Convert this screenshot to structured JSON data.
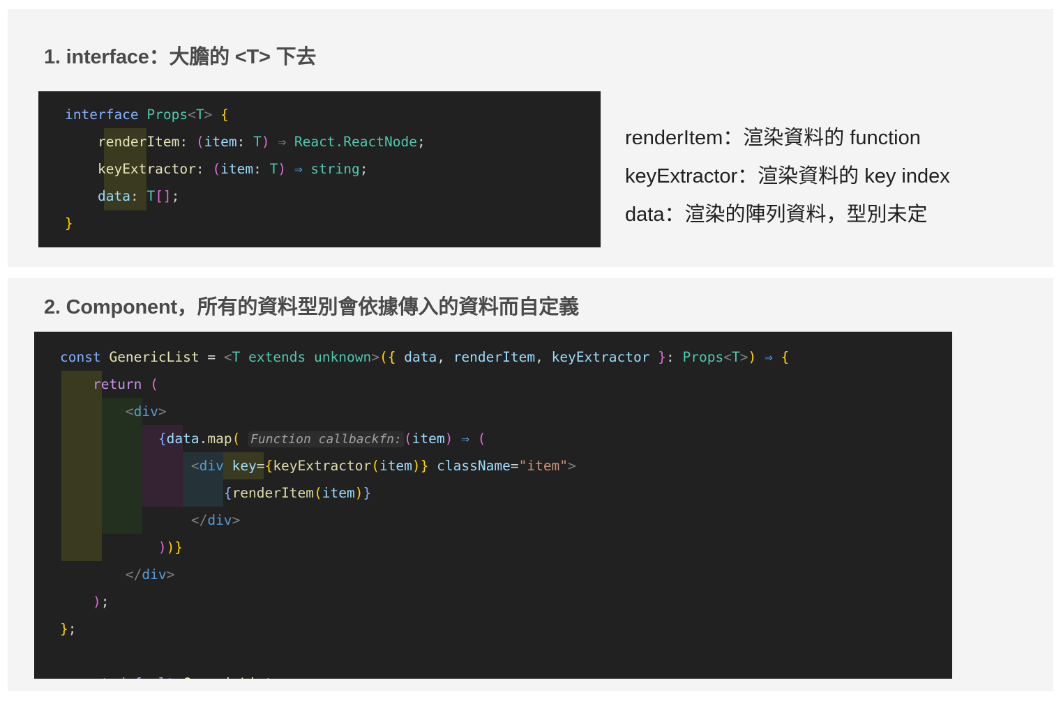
{
  "page": {
    "background": "#ffffff",
    "panel_background": "#f4f4f4",
    "code_background": "#212121"
  },
  "sections": [
    {
      "id": "section-1",
      "heading": "1. interface：大膽的 <T> 下去"
    },
    {
      "id": "section-2",
      "heading": "2. Component，所有的資料型別會依據傳入的資料而自定義"
    }
  ],
  "code_block_1": {
    "language": "typescript",
    "lines": [
      "interface Props<T> {",
      "    renderItem: (item: T) ⇒ React.ReactNode;",
      "    keyExtractor: (item: T) ⇒ string;",
      "    data: T[];",
      "}"
    ]
  },
  "code_block_2": {
    "language": "tsx",
    "lines": [
      "const GenericList = <T extends unknown>({ data, renderItem, keyExtractor }: Props<T>) ⇒ {",
      "    return (",
      "        <div>",
      "            {data.map( Function callbackfn: (item) ⇒ (",
      "                <div key={keyExtractor(item)} className=\"item\">",
      "                    {renderItem(item)}",
      "                </div>",
      "            ))}",
      "        </div>",
      "    );",
      "};",
      "",
      "export default GenericList;"
    ],
    "inlay_hint": "Function callbackfn:"
  },
  "annotations": [
    "renderItem：渲染資料的 function",
    "keyExtractor：渲染資料的 key index",
    "data：渲染的陣列資料，型別未定"
  ],
  "colors": {
    "keyword": "#c792ea",
    "keyword_blue": "#82b1ff",
    "type": "#4ec9b0",
    "identifier": "#e6e6b8",
    "parameter": "#9cdcfe",
    "brace_yellow": "#ffd700",
    "brace_magenta": "#e06bdb",
    "string": "#ce9178",
    "tag": "#569cd6",
    "inlay_hint": "#a0a0a0",
    "heading": "#4a4a4a",
    "annotation_text": "#202020",
    "indent_guide_1": "#3a3a20",
    "indent_guide_2": "#23301f",
    "indent_guide_3": "#352233",
    "indent_guide_4": "#253338"
  }
}
